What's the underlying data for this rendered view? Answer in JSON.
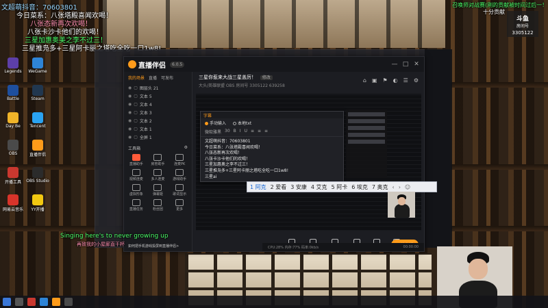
{
  "overlay": {
    "top_left_lines": [
      "文超萌抖音：70603801",
      "今日菜系：八张塔殿喜闻欢喝！",
      "八张态新再次欢喝！",
      "八张卡沙卡他们的欢喝！",
      "三星加惠奥美之李不过三！",
      "三星推凫多+三星阿卡丽之塔吃全吃一口1w8!"
    ],
    "top_right_lines": [
      "召唤师对战赛(刚的贡献被时间过后一！",
      "十分贡献"
    ],
    "bottom_left_line": "Singing here's to never growing up",
    "bottom_left_sub": "再致我的小屋廊直干杯"
  },
  "badge": {
    "logo": "斗鱼",
    "room_label": "房间号",
    "room_number": "3305122"
  },
  "desktop_icons": [
    {
      "label": "Legends",
      "color": "#5d3fa8"
    },
    {
      "label": "WeGame",
      "color": "#2e84d6"
    },
    {
      "label": "Battle",
      "color": "#1e4f9e"
    },
    {
      "label": "Steam",
      "color": "#21374f"
    },
    {
      "label": "Day Be",
      "color": "#f0b429"
    },
    {
      "label": "Tencent",
      "color": "#2aa3f2"
    },
    {
      "label": "OBS",
      "color": "#4a4a4a"
    },
    {
      "label": "直播伴侣",
      "color": "#ff9b1a"
    },
    {
      "label": "开播工具",
      "color": "#c9382f"
    },
    {
      "label": "OBS Studio",
      "color": "#2b2b2b"
    },
    {
      "label": "网易云音乐",
      "color": "#d8342a"
    },
    {
      "label": "YY开播",
      "color": "#f2c811"
    }
  ],
  "app": {
    "logo_text": "直播伴侣",
    "version": "6.0.5",
    "window_controls": [
      "—",
      "□",
      "✕"
    ],
    "left_tabs": [
      "我的场景",
      "直播",
      "可发布"
    ],
    "scenes": [
      {
        "name": "图层头 21"
      },
      {
        "name": "文本 5"
      },
      {
        "name": "文本 4"
      },
      {
        "name": "文本 3"
      },
      {
        "name": "文本 2"
      },
      {
        "name": "文本 1"
      },
      {
        "name": "全屏 1"
      }
    ],
    "tools_label": "工具箱",
    "tools": [
      {
        "label": "直播助手",
        "hot": true
      },
      {
        "label": "房管助手",
        "hot": false
      },
      {
        "label": "连麦PK",
        "hot": false
      },
      {
        "label": "视频连麦",
        "hot": false
      },
      {
        "label": "多人连麦",
        "hot": false
      },
      {
        "label": "游戏助手",
        "hot": false
      },
      {
        "label": "虚拟形象",
        "hot": false
      },
      {
        "label": "弹幕姬",
        "hot": false
      },
      {
        "label": "歌词显示",
        "hot": false
      },
      {
        "label": "直播任务",
        "hot": false
      },
      {
        "label": "粉丝团",
        "hot": false
      },
      {
        "label": "更多",
        "hot": false
      }
    ],
    "left_footer": "如何把手机游戏投屏到直播伴侣>",
    "stream_title": "三星你惹来大战三星盖厉！",
    "edit_label": "修改",
    "stream_meta": "大头/英雄联盟  OBS  房间号 3305122  639258",
    "right_tool_icons": [
      "⌂",
      "▣",
      "⚑",
      "◐",
      "☰",
      "⚙"
    ],
    "dialog": {
      "title": "字幕",
      "mode_manual": "手动输入",
      "mode_file": "本地txt",
      "toolbar": [
        "微软雅黑",
        "30",
        "B",
        "I",
        "U",
        "≡",
        "≡",
        "≡"
      ],
      "lines": [
        "文超萌抖音：70603801",
        "今日菜系：八张塔殿喜闻欢喝！",
        "八张态新再次欢喝！",
        "八张卡沙卡他们的欢喝！",
        "三星加惠奥之李不过三！",
        "三星推凫多+三星阿卡丽之塔吃全吃一口1w8!",
        "三星ai"
      ]
    },
    "ime": {
      "candidates": [
        "1 阿克",
        "2 爱看",
        "3 安康",
        "4 艾克",
        "5 阿卡",
        "6 埃克",
        "7 奥克"
      ],
      "nav": [
        "‹",
        "›"
      ],
      "emoji": "☺"
    },
    "controls": [
      "直播屏幕",
      "摄像头",
      "手机投屏",
      "多媒体",
      "麦克风",
      "扬声器"
    ],
    "go_live": "开始直播",
    "status_left": "CPU:28%  内存:77%  码率:0kb/s",
    "status_right": "00:00:00"
  }
}
